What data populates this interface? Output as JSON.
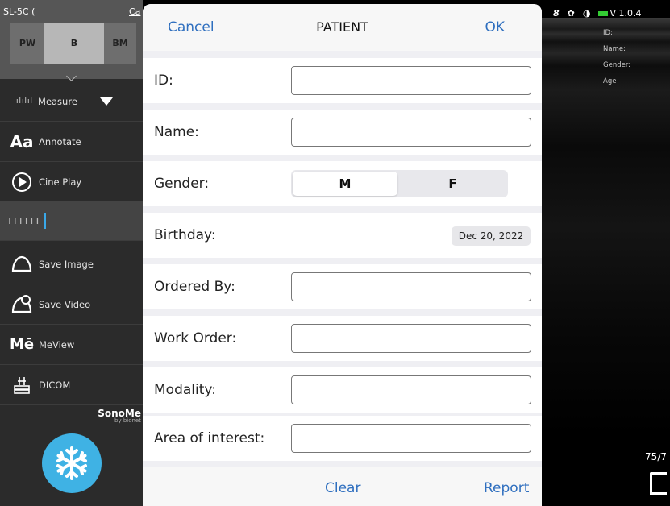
{
  "sidebar": {
    "probe": "SL-5C (",
    "probe_tail": "Ca",
    "modes": [
      "PW",
      "B",
      "BM"
    ],
    "items": {
      "measure": "Measure",
      "annotate": "Annotate",
      "cine_play": "Cine Play",
      "save_image": "Save Image",
      "save_video": "Save Video",
      "meview": "MeView",
      "dicom": "DICOM"
    },
    "icons": {
      "measure": "ruler-icon",
      "annotate": "text-aa-icon",
      "cine_play": "play-icon",
      "gain": "gain-slider-icon",
      "save_image": "probe-image-icon",
      "save_video": "probe-video-icon",
      "meview": "meview-icon",
      "dicom": "dicom-icon",
      "freeze": "snowflake-icon"
    },
    "brand": "SonoMe",
    "brand_sub": "by bionet",
    "accent": "#3fb2e4"
  },
  "dialog": {
    "title": "PATIENT",
    "cancel": "Cancel",
    "ok": "OK",
    "fields": {
      "id": {
        "label": "ID:",
        "value": ""
      },
      "name": {
        "label": "Name:",
        "value": ""
      },
      "gender": {
        "label": "Gender:",
        "options": [
          "M",
          "F"
        ],
        "selected": "M"
      },
      "birthday": {
        "label": "Birthday:",
        "value": "Dec 20, 2022"
      },
      "ordered_by": {
        "label": "Ordered By:",
        "value": ""
      },
      "work_order": {
        "label": "Work Order:",
        "value": ""
      },
      "modality": {
        "label": "Modality:",
        "value": ""
      },
      "area": {
        "label": "Area of interest:",
        "value": ""
      }
    },
    "clear": "Clear",
    "report": "Report",
    "link_color": "#2f6fbf"
  },
  "ultrasound": {
    "version": "V 1.0.4",
    "meta": [
      "ID:",
      "Name:",
      "Gender:",
      "Age"
    ],
    "frame": "75/7",
    "status_icons": [
      "user-icon",
      "gear-icon",
      "contrast-icon",
      "battery-icon"
    ]
  }
}
